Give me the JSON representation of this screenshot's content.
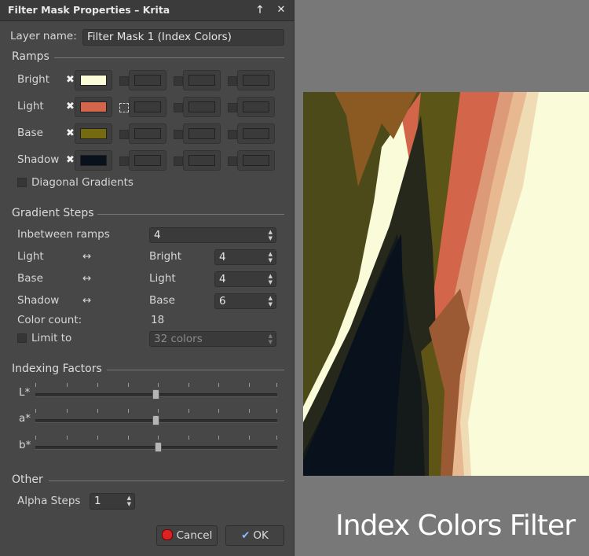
{
  "window": {
    "title": "Filter Mask Properties – Krita",
    "pin_icon": "pin-up-icon",
    "close_icon": "close-icon"
  },
  "layer": {
    "label": "Layer name:",
    "value": "Filter Mask 1 (Index Colors)"
  },
  "ramps": {
    "heading": "Ramps",
    "rows": [
      {
        "label": "Bright",
        "color": "#fafcd8"
      },
      {
        "label": "Light",
        "color": "#d2654a"
      },
      {
        "label": "Base",
        "color": "#756a10"
      },
      {
        "label": "Shadow",
        "color": "#08111c"
      }
    ],
    "diagonal_label": "Diagonal Gradients"
  },
  "gradient_steps": {
    "heading": "Gradient Steps",
    "inbetween_label": "Inbetween ramps",
    "inbetween_value": "4",
    "arrow": "↔",
    "rows": [
      {
        "from": "Light",
        "to": "Bright",
        "value": "4"
      },
      {
        "from": "Base",
        "to": "Light",
        "value": "4"
      },
      {
        "from": "Shadow",
        "to": "Base",
        "value": "6"
      }
    ],
    "color_count_label": "Color count:",
    "color_count_value": "18",
    "limit_label": "Limit to",
    "limit_value": "32 colors"
  },
  "indexing": {
    "heading": "Indexing Factors",
    "sliders": [
      {
        "label": "L*",
        "value": 0.5
      },
      {
        "label": "a*",
        "value": 0.5
      },
      {
        "label": "b*",
        "value": 0.51
      }
    ]
  },
  "other": {
    "heading": "Other",
    "alpha_label": "Alpha Steps",
    "alpha_value": "1"
  },
  "buttons": {
    "cancel": "Cancel",
    "ok": "OK"
  },
  "caption": "Index Colors Filter"
}
